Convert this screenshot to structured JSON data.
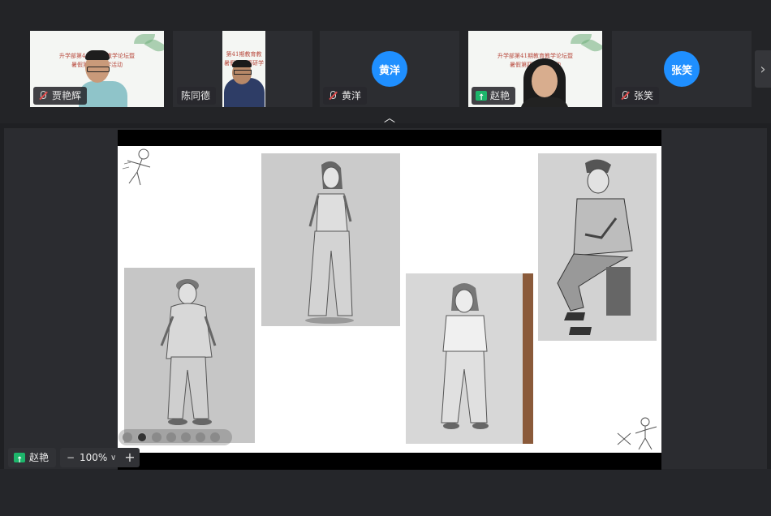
{
  "participants": [
    {
      "name": "贾艳辉",
      "type": "video",
      "mic_muted": true
    },
    {
      "name": "陈同德",
      "type": "video",
      "mic_muted": false
    },
    {
      "name": "黄洋",
      "type": "avatar",
      "avatar_text": "黄洋",
      "mic_muted": true
    },
    {
      "name": "赵艳",
      "type": "video",
      "sharing": true
    },
    {
      "name": "张笑",
      "type": "avatar",
      "avatar_text": "张笑",
      "mic_muted": true
    }
  ],
  "slide_bg_text": {
    "line1": "升学部第41期教育教学论坛暨",
    "line2": "暑假第四周研学活动",
    "tile2_line1": "第41期教育教",
    "tile2_line2": "暑假第四周研学"
  },
  "icons": {
    "next": "chevron-right-icon",
    "collapse": "chevron-up-icon"
  },
  "collapse_glyph": "︿",
  "next_glyph": "›",
  "presenter": {
    "name": "赵艳"
  },
  "zoom": {
    "minus": "−",
    "value": "100%",
    "caret": "∨",
    "plus": "+"
  },
  "colors": {
    "avatar_blue": "#1f8fff",
    "share_green": "#1db66b",
    "muted_red": "#e04b4b"
  }
}
